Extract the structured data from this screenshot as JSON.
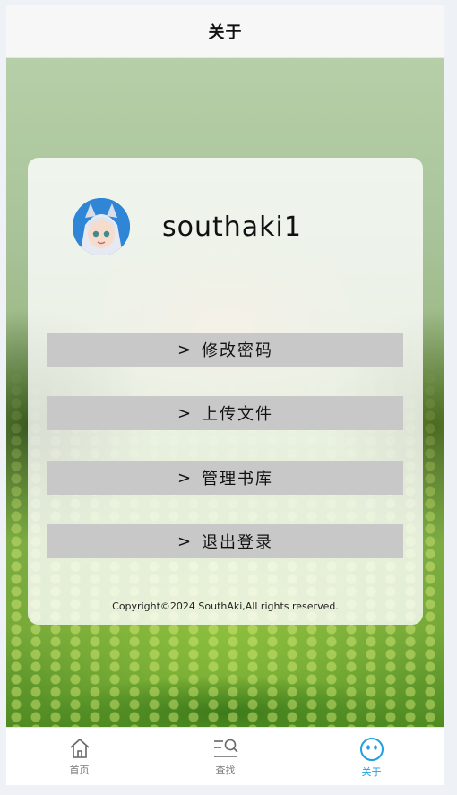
{
  "navbar": {
    "title": "关于"
  },
  "profile": {
    "username": "southaki1"
  },
  "menu": [
    {
      "chevron": ">",
      "label": "修改密码"
    },
    {
      "chevron": ">",
      "label": "上传文件"
    },
    {
      "chevron": ">",
      "label": "管理书库"
    },
    {
      "chevron": ">",
      "label": "退出登录"
    }
  ],
  "footer": {
    "copyright": "Copyright©2024 SouthAki,All rights reserved."
  },
  "tabbar": [
    {
      "label": "首页",
      "icon": "home-icon",
      "active": false
    },
    {
      "label": "查找",
      "icon": "search-list-icon",
      "active": false
    },
    {
      "label": "关于",
      "icon": "smiley-icon",
      "active": true
    }
  ],
  "colors": {
    "accent": "#20a0e0",
    "button_bg": "#c8c8c8"
  }
}
